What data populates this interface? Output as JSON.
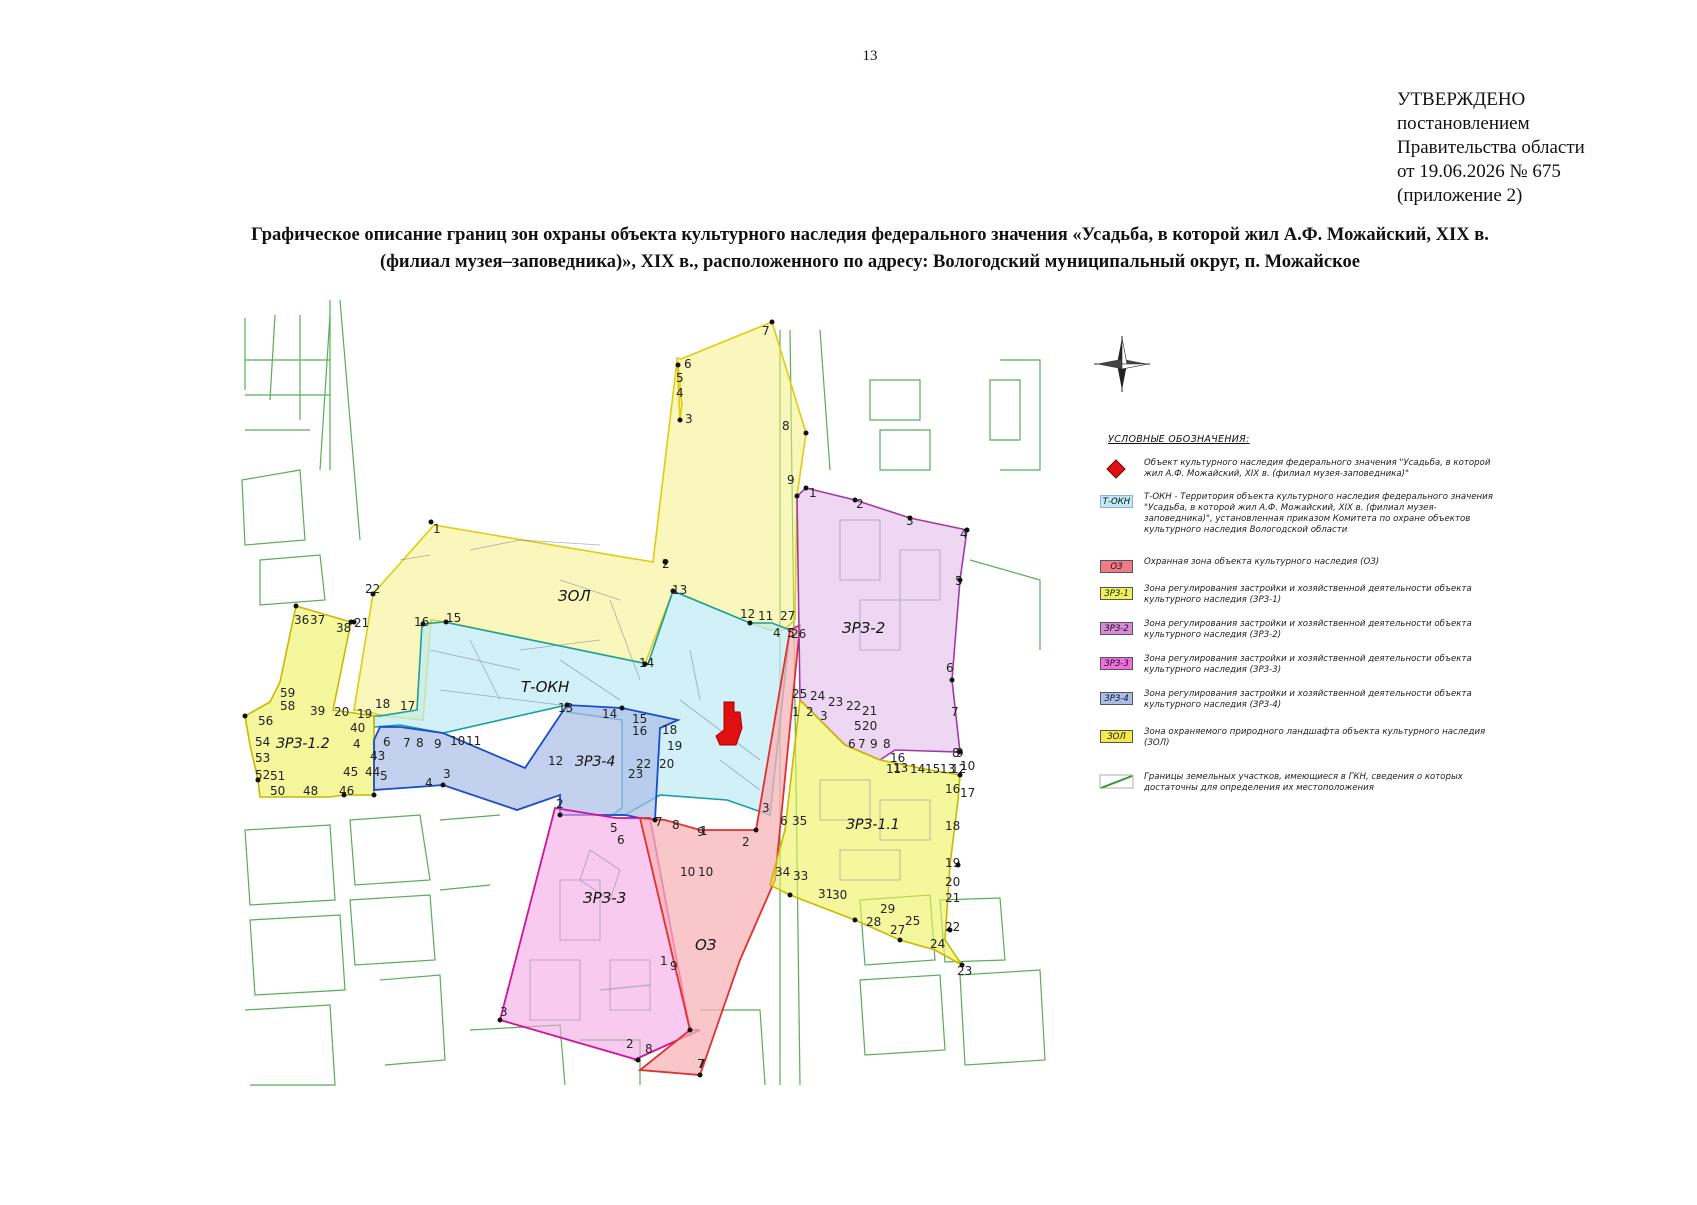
{
  "page_number": "13",
  "approval": {
    "line1": "УТВЕРЖДЕНО",
    "line2": "постановлением",
    "line3": "Правительства области",
    "line4": "от 19.06.2026 № 675",
    "line5": "(приложение 2)"
  },
  "title": {
    "line1": "Графическое описание границ зон охраны объекта культурного наследия федерального значения «Усадьба, в которой жил А.Ф. Можайский, XIX в.",
    "line2": "(филиал музея–заповедника)», XIX в., расположенного по адресу: Вологодский муниципальный округ, п. Можайское"
  },
  "map": {
    "zones": {
      "zol": "ЗОЛ",
      "tokn": "Т-ОКН",
      "zrz1_1": "ЗРЗ-1.1",
      "zrz1_2": "ЗРЗ-1.2",
      "zrz2": "ЗРЗ-2",
      "zrz3": "ЗРЗ-3",
      "zrz4": "ЗРЗ-4",
      "oz": "ОЗ"
    },
    "colors": {
      "zol": "#f5f07a",
      "tokn": "#bfeaf5",
      "oz": "#f7b3b8",
      "zrz1": "#eef25a",
      "zrz2": "#e6c6ec",
      "zrz3": "#f4a6e6",
      "zrz4": "#a9bde8",
      "object": "#e01010",
      "parcels": "#3aa13a"
    },
    "compass_icon": "north-arrow-compass-rose"
  },
  "legend": {
    "heading": "УСЛОВНЫЕ ОБОЗНАЧЕНИЯ:",
    "items": [
      {
        "icon": "red-diamond",
        "code": "",
        "text": "Объект культурного наследия федерального значения \"Усадьба, в которой жил А.Ф. Можайский, XIX в. (филиал музея-заповедника)\""
      },
      {
        "icon": "swatch",
        "code": "Т-ОКН",
        "text": "Т-ОКН - Территория объекта культурного наследия федерального значения \"Усадьба, в которой жил А.Ф. Можайский, XIX в. (филиал музея-заповедника)\", установленная приказом Комитета по охране объектов культурного наследия Вологодской области"
      },
      {
        "icon": "swatch",
        "code": "ОЗ",
        "text": "Охранная зона объекта культурного наследия (ОЗ)"
      },
      {
        "icon": "swatch",
        "code": "ЗРЗ-1",
        "text": "Зона регулирования застройки и хозяйственной деятельности объекта культурного наследия (ЗРЗ-1)"
      },
      {
        "icon": "swatch",
        "code": "ЗРЗ-2",
        "text": "Зона регулирования застройки и хозяйственной деятельности объекта культурного наследия (ЗРЗ-2)"
      },
      {
        "icon": "swatch",
        "code": "ЗРЗ-3",
        "text": "Зона регулирования застройки и хозяйственной деятельности объекта культурного наследия (ЗРЗ-3)"
      },
      {
        "icon": "swatch",
        "code": "ЗРЗ-4",
        "text": "Зона регулирования застройки и хозяйственной деятельности объекта культурного наследия (ЗРЗ-4)"
      },
      {
        "icon": "swatch",
        "code": "ЗОЛ",
        "text": "Зона охраняемого природного ландшафта объекта культурного наследия (ЗОЛ)"
      },
      {
        "icon": "green-line",
        "code": "",
        "text": "Границы земельных участков, имеющиеся в ГКН, сведения о которых достаточны для определения их местоположения"
      }
    ]
  }
}
